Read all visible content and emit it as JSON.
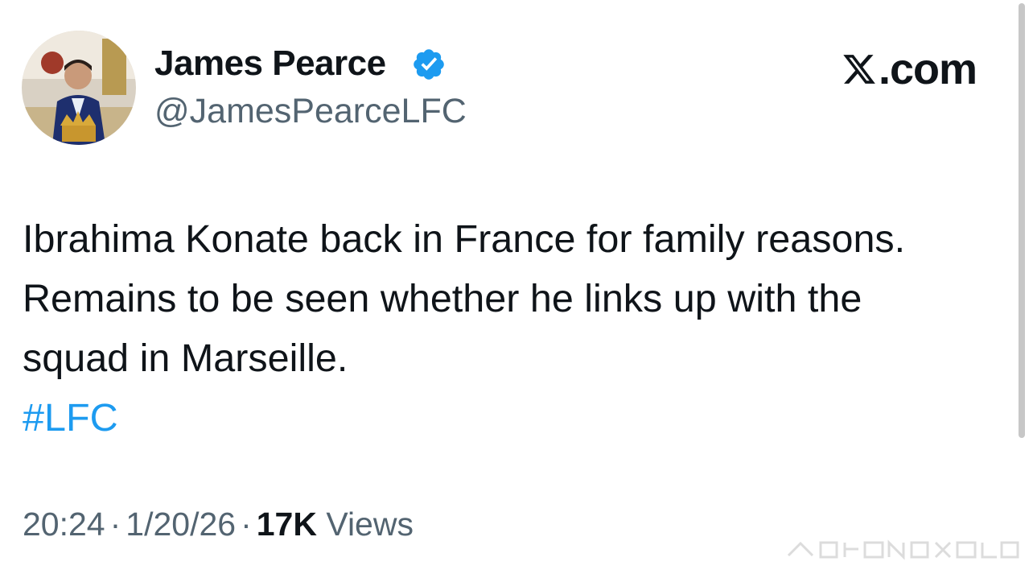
{
  "author": {
    "display_name": "James Pearce",
    "handle": "@JamesPearceLFC",
    "verified": true,
    "verified_icon": "verified-badge-icon",
    "avatar_icon": "profile-avatar"
  },
  "brand": {
    "logo_icon": "x-logo-icon",
    "domain_suffix": ".com"
  },
  "tweet": {
    "lines": [
      "Ibrahima Konate back in France for family reasons.",
      "Remains to be seen whether he links up with the",
      "squad in Marseille."
    ],
    "hashtag": "#LFC"
  },
  "meta": {
    "time": "20:24",
    "separator": "·",
    "date": "1/20/26",
    "views_count": "17K",
    "views_label": "Views"
  },
  "colors": {
    "text": "#0f1419",
    "secondary": "#536471",
    "accent": "#1d9bf0",
    "verified": "#1d9bf0"
  }
}
